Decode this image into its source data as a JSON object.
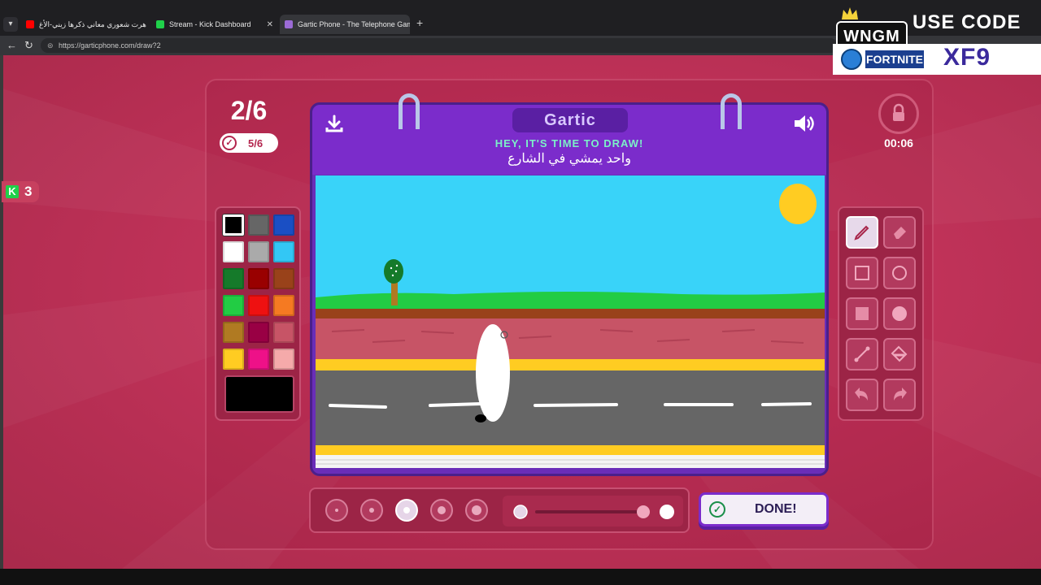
{
  "browser": {
    "tabs": [
      {
        "label": "هرت شعوري معاني ذكرها زيني-الأغ",
        "active": false,
        "favicon_color": "#ff0000"
      },
      {
        "label": "Stream - Kick Dashboard",
        "active": false,
        "favicon_color": "#1fd14a"
      },
      {
        "label": "Gartic Phone - The Telephone Gam",
        "active": true,
        "favicon_color": "#9b6bd6"
      }
    ],
    "new_tab": "+",
    "url": "https://garticphone.com/draw?2"
  },
  "kick_viewers": {
    "count": "3"
  },
  "game": {
    "round": "2/6",
    "completed": "5/6",
    "timer": "00:06",
    "logo": "Gartic",
    "hint_title": "HEY, IT'S TIME TO DRAW!",
    "hint_sentence": "واحد يمشي في الشارع",
    "done_label": "DONE!"
  },
  "palette": {
    "colors": [
      "#000000",
      "#666666",
      "#1a4fc4",
      "#ffffff",
      "#aaaaaa",
      "#33c7f5",
      "#157a2a",
      "#990000",
      "#99421a",
      "#22cc44",
      "#ee1111",
      "#f57a22",
      "#b07a22",
      "#990044",
      "#c75466",
      "#ffcc22",
      "#ee1188",
      "#f5aaaa"
    ],
    "selected_index": 0,
    "current_color": "#000000"
  },
  "tools": {
    "items": [
      "pencil-tool",
      "eraser-tool",
      "rect-outline-tool",
      "ellipse-outline-tool",
      "rect-filled-tool",
      "ellipse-filled-tool",
      "line-tool",
      "fill-bucket-tool",
      "undo-tool",
      "redo-tool"
    ],
    "selected": "pencil-tool"
  },
  "brush": {
    "sizes": [
      1,
      2,
      3,
      4,
      5
    ],
    "selected_size_index": 2,
    "opacity": 1.0
  },
  "overlay": {
    "brand": "WNGM",
    "use_code_label": "USE CODE",
    "game_label": "FORTNITE",
    "code": "XF9"
  }
}
